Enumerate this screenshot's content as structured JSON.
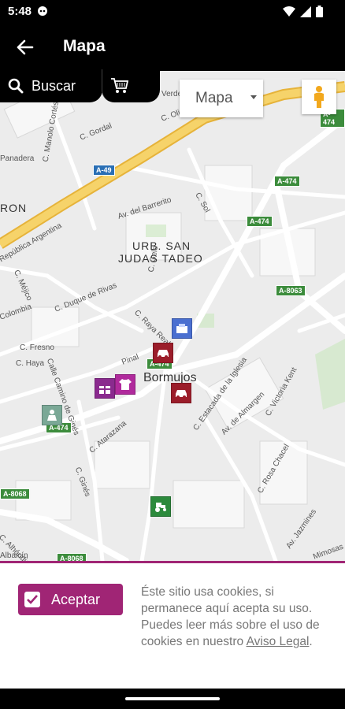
{
  "status": {
    "time": "5:48"
  },
  "appbar": {
    "title": "Mapa"
  },
  "search": {
    "label": "Buscar"
  },
  "map_controls": {
    "map_type": "Mapa"
  },
  "map": {
    "streets": [
      "Verde",
      "C. Olivo",
      "C. Gordal",
      "C. Manolo Cortés",
      "Panadera",
      "RON",
      "Av. del Barrerito",
      "C. Sol",
      "República Argentina",
      "URB. SAN",
      "JUDAS TADEO",
      "C. Méjico",
      "Colombia",
      "C. Duque de Rivas",
      "C. Gelo",
      "C. Raya Real",
      "C. Fresno",
      "C. Haya",
      "Calle Camino de Ginés",
      "Pinal",
      "Bormujos",
      "C. Estacada de la Iglesia",
      "Av. de Almargen",
      "C. Victoria Kent",
      "C. Atarazana",
      "C. Ginés",
      "C. Rosa Chacel",
      "C. Alhóndiga",
      "Albaicín",
      "Av. Jazmines",
      "Mimosas"
    ],
    "road_badges": [
      "A-474",
      "A-49",
      "A-474",
      "A-474",
      "A-8063",
      "A-474",
      "A-474",
      "A-8068",
      "A-8068"
    ]
  },
  "cookie": {
    "accept_label": "Aceptar",
    "text_main": "Éste sitio usa cookies, si permanece aquí acepta su uso.",
    "text_more": "Puedes leer más sobre el uso de cookies en nuestro ",
    "link_label": "Aviso Legal",
    "text_end": "."
  },
  "colors": {
    "accent": "#a02575",
    "highway": "#f3c44c",
    "park": "#cfe8c4"
  }
}
